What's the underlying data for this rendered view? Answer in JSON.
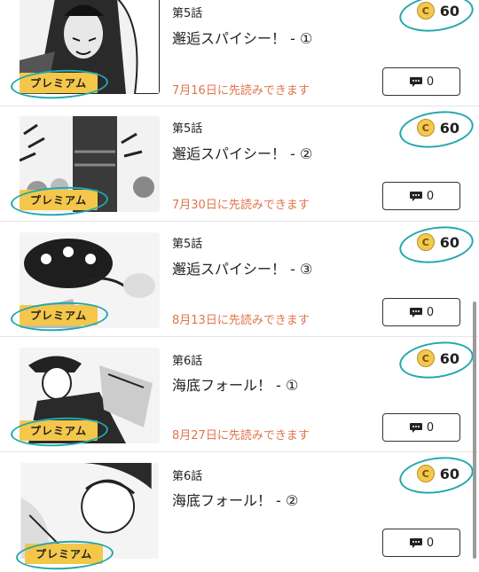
{
  "episodes": [
    {
      "episode": "第5話",
      "title": "邂逅スパイシー！ - ①",
      "badge": "プレミアム",
      "early_read": "7月16日に先読みできます",
      "price": "60",
      "coin_symbol": "C",
      "comments": "0"
    },
    {
      "episode": "第5話",
      "title": "邂逅スパイシー！ - ②",
      "badge": "プレミアム",
      "early_read": "7月30日に先読みできます",
      "price": "60",
      "coin_symbol": "C",
      "comments": "0"
    },
    {
      "episode": "第5話",
      "title": "邂逅スパイシー！ - ③",
      "badge": "プレミアム",
      "early_read": "8月13日に先読みできます",
      "price": "60",
      "coin_symbol": "C",
      "comments": "0"
    },
    {
      "episode": "第6話",
      "title": "海底フォール！ - ①",
      "badge": "プレミアム",
      "early_read": "8月27日に先読みできます",
      "price": "60",
      "coin_symbol": "C",
      "comments": "0"
    },
    {
      "episode": "第6話",
      "title": "海底フォール！ - ②",
      "badge": "プレミアム",
      "early_read": "",
      "price": "60",
      "coin_symbol": "C",
      "comments": "0"
    }
  ],
  "colors": {
    "accent_teal": "#22a8ad",
    "badge_yellow": "#f4c74a",
    "early_orange": "#e0744a"
  },
  "icons": {
    "coin": "coin-icon",
    "comment": "comment-bubble-icon"
  }
}
